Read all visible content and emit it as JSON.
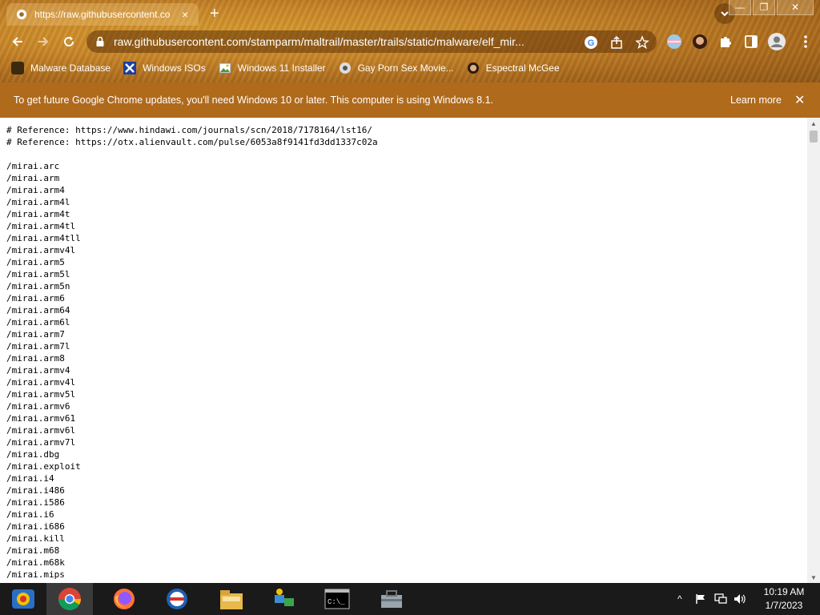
{
  "tab": {
    "title": "https://raw.githubusercontent.co",
    "close": "×"
  },
  "newtab": "+",
  "window": {
    "minimize": "—",
    "restore": "❐",
    "close": "✕"
  },
  "omnibox": {
    "url": "raw.githubusercontent.com/stamparm/maltrail/master/trails/static/malware/elf_mir..."
  },
  "bookmarks": [
    {
      "label": "Malware Database",
      "icon": "malware-icon"
    },
    {
      "label": "Windows ISOs",
      "icon": "x-logo-icon"
    },
    {
      "label": "Windows 11 Installer",
      "icon": "image-icon"
    },
    {
      "label": "Gay Porn Sex Movie...",
      "icon": "site-icon"
    },
    {
      "label": "Espectral McGee",
      "icon": "avatar-icon"
    }
  ],
  "infobar": {
    "message": "To get future Google Chrome updates, you'll need Windows 10 or later. This computer is using Windows 8.1.",
    "learn_more": "Learn more",
    "close": "✕"
  },
  "content": {
    "lines": [
      "# Reference: https://www.hindawi.com/journals/scn/2018/7178164/lst16/",
      "# Reference: https://otx.alienvault.com/pulse/6053a8f9141fd3dd1337c02a",
      "",
      "/mirai.arc",
      "/mirai.arm",
      "/mirai.arm4",
      "/mirai.arm4l",
      "/mirai.arm4t",
      "/mirai.arm4tl",
      "/mirai.arm4tll",
      "/mirai.armv4l",
      "/mirai.arm5",
      "/mirai.arm5l",
      "/mirai.arm5n",
      "/mirai.arm6",
      "/mirai.arm64",
      "/mirai.arm6l",
      "/mirai.arm7",
      "/mirai.arm7l",
      "/mirai.arm8",
      "/mirai.armv4",
      "/mirai.armv4l",
      "/mirai.armv5l",
      "/mirai.armv6",
      "/mirai.armv61",
      "/mirai.armv6l",
      "/mirai.armv7l",
      "/mirai.dbg",
      "/mirai.exploit",
      "/mirai.i4",
      "/mirai.i486",
      "/mirai.i586",
      "/mirai.i6",
      "/mirai.i686",
      "/mirai.kill",
      "/mirai.m68",
      "/mirai.m68k",
      "/mirai.mips"
    ]
  },
  "taskbar": {
    "apps": [
      "start-orb-icon",
      "chrome-icon",
      "firefox-icon",
      "office-icon",
      "file-explorer-icon",
      "network-app-icon",
      "command-prompt-icon",
      "toolbox-icon"
    ],
    "cmd_label": "C:\\_",
    "tray_arrow": "^"
  },
  "clock": {
    "time": "10:19 AM",
    "date": "1/7/2023"
  },
  "colors": {
    "infobar": "#b06a1b",
    "taskbar": "#1a1a1a"
  }
}
